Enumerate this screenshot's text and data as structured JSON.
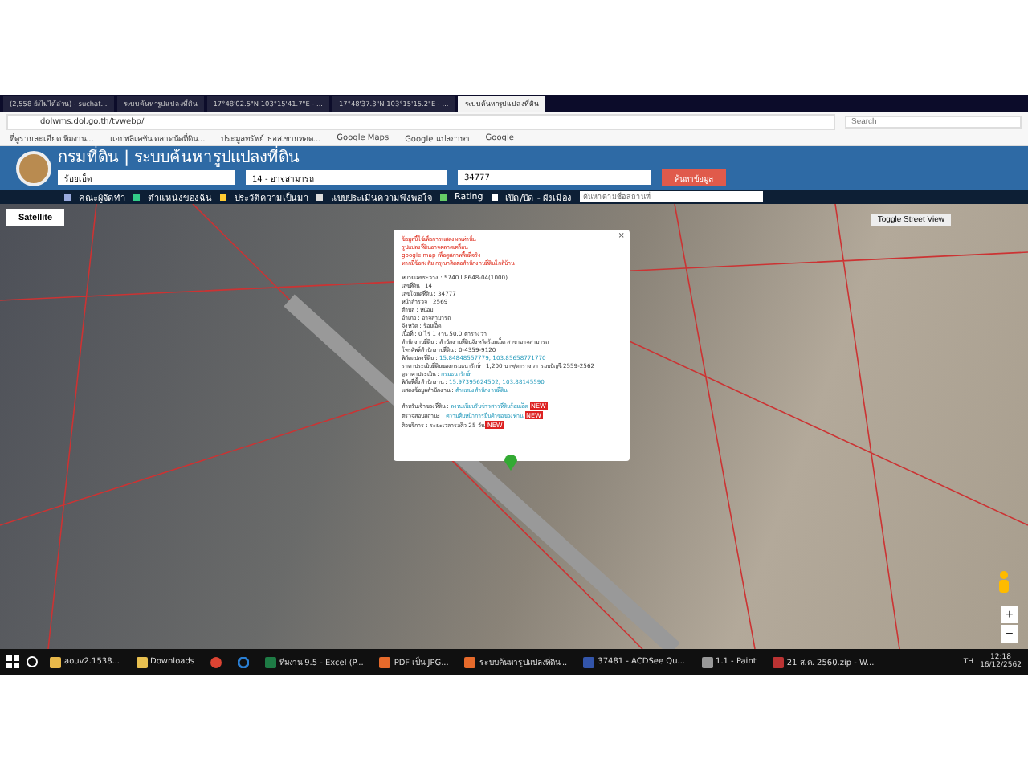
{
  "browser": {
    "tabs": [
      {
        "label": "(2,558 ยังไม่ได้อ่าน) - suchat...",
        "selected": false
      },
      {
        "label": "ระบบค้นหารูปแปลงที่ดิน",
        "selected": false
      },
      {
        "label": "17°48'02.5\"N 103°15'41.7\"E - ...",
        "selected": false
      },
      {
        "label": "17°48'37.3\"N 103°15'15.2\"E - ...",
        "selected": false
      },
      {
        "label": "ระบบค้นหารูปแปลงที่ดิน",
        "selected": true
      }
    ],
    "url": "dolwms.dol.go.th/tvwebp/",
    "search_placeholder": "Search",
    "bookmarks": [
      "ที่ดูรายละเอียด ทีมงาน...",
      "แอปพลิเคชัน ตลาดนัดที่ดิน...",
      "ประมูลทรัพย์ ธอส.ขายทอด...",
      "Google Maps",
      "Google แปลภาษา",
      "Google"
    ]
  },
  "header": {
    "title": "กรมที่ดิน | ระบบค้นหารูปแปลงที่ดิน",
    "province": "ร้อยเอ็ด",
    "district": "14 - อาจสามารถ",
    "parcel": "34777",
    "search_button": "ค้นหาข้อมูล"
  },
  "nav": [
    {
      "label": "คณะผู้จัดทำ"
    },
    {
      "label": "ตำแหน่งของฉัน"
    },
    {
      "label": "ประวัติความเป็นมา"
    },
    {
      "label": "แบบประเมินความพึงพอใจ"
    },
    {
      "label": "Rating"
    },
    {
      "label": "เปิด/ปิด - ผังเมือง"
    }
  ],
  "place_search_placeholder": "ค้นหาตามชื่อสถานที่",
  "map": {
    "map_type": "Satellite",
    "street_view_button": "Toggle Street View",
    "close_symbol": "×",
    "zoom_in": "+",
    "zoom_out": "−",
    "popup": [
      {
        "kind": "warning",
        "text": "ข้อมูลนี้ใช้เพื่อการแสดงผลเท่านั้น"
      },
      {
        "kind": "warning",
        "text": "รูปแปลงที่ดินอาจคลาดเคลื่อน"
      },
      {
        "kind": "warning",
        "text": "google map เพื่อดูสภาพพื้นที่จริง"
      },
      {
        "kind": "warning",
        "text": "หากมีข้อสงสัย กรุณาติดต่อสำนักงานที่ดินใกล้บ้าน"
      },
      {
        "kind": "gap"
      },
      {
        "kind": "field",
        "label": "หมายเลขระวาง :",
        "value": "5740 I 8648-04(1000)"
      },
      {
        "kind": "field",
        "label": "เลขที่ดิน :",
        "value": "14"
      },
      {
        "kind": "field",
        "label": "เลขโฉนดที่ดิน :",
        "value": "34777"
      },
      {
        "kind": "field",
        "label": "หน้าสำรวจ :",
        "value": "2569"
      },
      {
        "kind": "field",
        "label": "ตำบล :",
        "value": "หน่อม"
      },
      {
        "kind": "field",
        "label": "อำเภอ :",
        "value": "อาจสามารถ"
      },
      {
        "kind": "field",
        "label": "จังหวัด :",
        "value": "ร้อยเอ็ด"
      },
      {
        "kind": "field",
        "label": "เนื้อที่ :",
        "value": "0 ไร่ 1 งาน 50.0 ตารางวา"
      },
      {
        "kind": "field",
        "label": "สำนักงานที่ดิน :",
        "value": "สำนักงานที่ดินจังหวัดร้อยเอ็ด สาขาอาจสามารถ"
      },
      {
        "kind": "field",
        "label": "โทรศัพท์สำนักงานที่ดิน :",
        "value": "0-4359-9120"
      },
      {
        "kind": "link",
        "label": "พิกัดแปลงที่ดิน :",
        "value": "15.84848557779, 103.85658771770"
      },
      {
        "kind": "field",
        "label": "ราคาประเมินที่ดินของกรมธนารักษ์ :",
        "value": "1,200 บาท/ตารางวา รอบบัญชี 2559-2562"
      },
      {
        "kind": "link",
        "label": "ดูราคาประเมิน :",
        "value": "กรมธนารักษ์"
      },
      {
        "kind": "link",
        "label": "พิกัดที่ตั้งสำนักงาน :",
        "value": "15.97395624502, 103.88145590"
      },
      {
        "kind": "link",
        "label": "แสดงข้อมูลสำนักงาน :",
        "value": "ตำแหน่งสำนักงานที่ดิน"
      },
      {
        "kind": "gap"
      },
      {
        "kind": "link",
        "label": "สำหรับเจ้าของที่ดิน :",
        "value": "ลงทะเบียนรับข่าวสารที่ดินร้อยเอ็ด",
        "badge": "NEW"
      },
      {
        "kind": "link",
        "label": "ตรวจสอบสถานะ :",
        "value": "ความคืบหน้าการยื่นคำขอของท่าน",
        "badge": "NEW"
      },
      {
        "kind": "field",
        "label": "คิวบริการ :",
        "value": "ระยะเวลารอคิว 25 วัน",
        "badge": "NEW"
      }
    ]
  },
  "taskbar": {
    "apps": [
      {
        "label": "aouv2.1538..."
      },
      {
        "label": "Downloads"
      },
      {
        "kind": "browser"
      },
      {
        "kind": "edge"
      },
      {
        "label": "ทีมงาน 9.5 - Excel (P..."
      },
      {
        "label": "PDF เป็น JPG..."
      },
      {
        "label": "ระบบค้นหารูปแปลงที่ดิน..."
      },
      {
        "label": "37481 - ACDSee Qu..."
      },
      {
        "label": "1.1 - Paint"
      },
      {
        "label": "21 ส.ค. 2560.zip - W..."
      }
    ],
    "language": "TH",
    "time": "12:18",
    "date": "16/12/2562"
  }
}
